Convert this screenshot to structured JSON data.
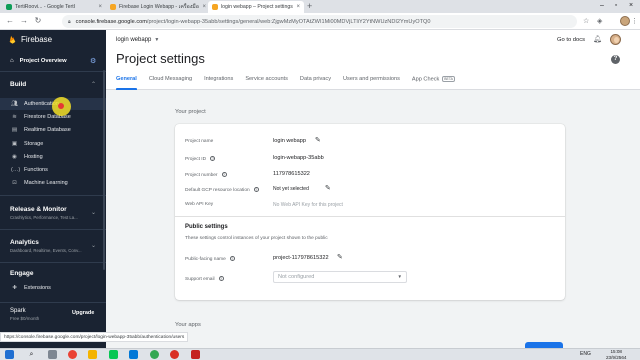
{
  "browser": {
    "tabs": [
      {
        "title": "TertiRoovi... - Google TertI",
        "icon": "gdocs-icon",
        "color": "#0f9d58"
      },
      {
        "title": "Firebase Login Webapp - เครื่องมือ",
        "icon": "firebase-icon",
        "color": "#f6a623"
      },
      {
        "title": "login webapp – Project settings",
        "icon": "firebase-icon",
        "color": "#f6a623"
      }
    ],
    "url_host": "console.firebase.google.com",
    "url_path": "/project/login-webapp-35abb/settings/general/web:ZjgwMzMyOTAtZWI1Mi00MDVjLTliY2YtNWUzNDI2YmUyOTQ0"
  },
  "sidebar": {
    "brand": "Firebase",
    "overview": "Project Overview",
    "sections": {
      "build": "Build",
      "release": "Release & Monitor",
      "release_sub": "Crashlytics, Performance, Test La...",
      "analytics": "Analytics",
      "analytics_sub": "Dashboard, Realtime, Events, Conv...",
      "engage": "Engage"
    },
    "build_items": [
      {
        "label": "Authentication",
        "icon": "people-icon"
      },
      {
        "label": "Firestore Database",
        "icon": "firestore-icon"
      },
      {
        "label": "Realtime Database",
        "icon": "database-icon"
      },
      {
        "label": "Storage",
        "icon": "storage-icon"
      },
      {
        "label": "Hosting",
        "icon": "hosting-icon"
      },
      {
        "label": "Functions",
        "icon": "functions-icon"
      },
      {
        "label": "Machine Learning",
        "icon": "ml-icon"
      }
    ],
    "extensions": "Extensions",
    "plan": "Spark",
    "plan_price": "Free $0/month",
    "upgrade": "Upgrade"
  },
  "header": {
    "project_picker": "login webapp",
    "go_to_docs": "Go to docs",
    "page_title": "Project settings"
  },
  "tabs": [
    "General",
    "Cloud Messaging",
    "Integrations",
    "Service accounts",
    "Data privacy",
    "Users and permissions",
    "App Check"
  ],
  "beta_badge": "BETA",
  "your_project": {
    "heading": "Your project",
    "rows": [
      {
        "label": "Project name",
        "value": "login webapp"
      },
      {
        "label": "Project ID",
        "value": "login-webapp-35abb"
      },
      {
        "label": "Project number",
        "value": "117978615322"
      },
      {
        "label": "Default GCP resource location",
        "value": "Not yet selected"
      },
      {
        "label": "Web API Key",
        "value": "No Web API Key for this project"
      }
    ],
    "public_settings": {
      "heading": "Public settings",
      "description": "These settings control instances of your project shown to the public",
      "public_name_label": "Public-facing name",
      "public_name_value": "project-117978615322",
      "support_email_label": "Support email",
      "support_email_value": "Not configured"
    }
  },
  "your_apps": "Your apps",
  "status_link": "https://console.firebase.google.com/project/login-webapp-35abb/authentication/users",
  "taskbar": {
    "language": "ENG",
    "time": "15:08",
    "date": "23/9/2564"
  },
  "colors": {
    "sidebar_bg": "#1a2332",
    "accent": "#1a73e8",
    "firebase_orange": "#f6a623"
  }
}
